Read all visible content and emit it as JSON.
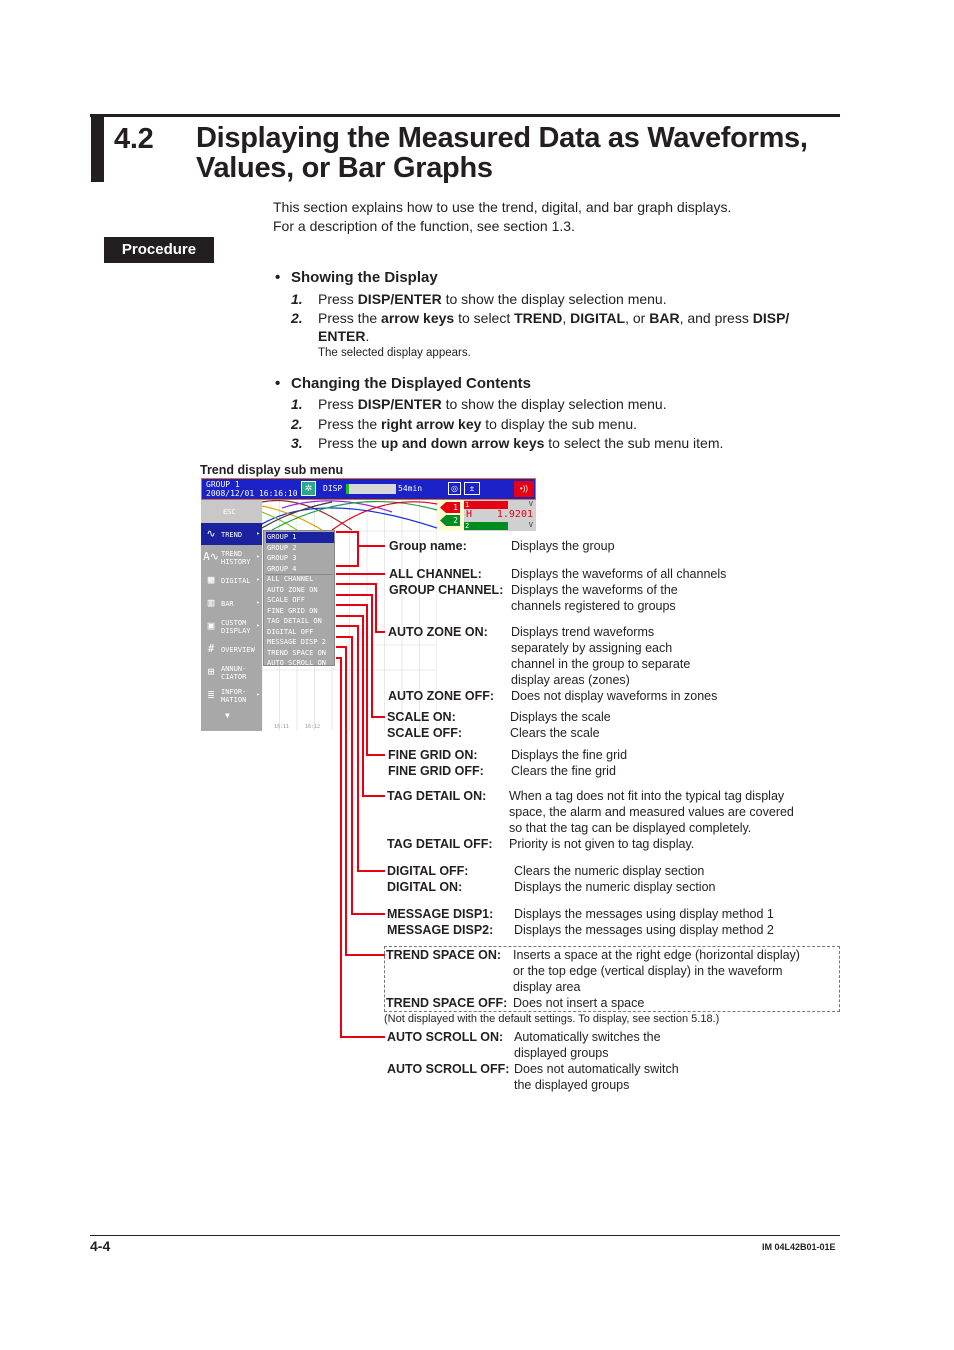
{
  "header": {
    "section_number": "4.2",
    "section_title": "Displaying the Measured Data as Waveforms, Values, or Bar Graphs",
    "intro_lines": [
      "This section explains how to use the trend, digital, and bar graph displays.",
      "For a description of the function, see section 1.3."
    ],
    "procedure_label": "Procedure"
  },
  "showing": {
    "heading": "Showing the Display",
    "steps": [
      {
        "num": "1.",
        "parts": [
          [
            "Press ",
            false
          ],
          [
            "DISP/ENTER",
            true
          ],
          [
            " to show the display selection menu.",
            false
          ]
        ]
      },
      {
        "num": "2.",
        "parts": [
          [
            "Press the ",
            false
          ],
          [
            "arrow keys",
            true
          ],
          [
            " to select ",
            false
          ],
          [
            "TREND",
            true
          ],
          [
            ", ",
            false
          ],
          [
            "DIGITAL",
            true
          ],
          [
            ", or ",
            false
          ],
          [
            "BAR",
            true
          ],
          [
            ", and press ",
            false
          ],
          [
            "DISP/",
            true
          ]
        ]
      },
      {
        "num": "",
        "parts": [
          [
            "ENTER",
            true
          ],
          [
            ".",
            false
          ]
        ]
      }
    ],
    "note": "The selected display appears."
  },
  "changing": {
    "heading": "Changing the Displayed Contents",
    "steps": [
      {
        "num": "1.",
        "parts": [
          [
            "Press ",
            false
          ],
          [
            "DISP/ENTER",
            true
          ],
          [
            " to show the display selection menu.",
            false
          ]
        ]
      },
      {
        "num": "2.",
        "parts": [
          [
            "Press the ",
            false
          ],
          [
            "right arrow key",
            true
          ],
          [
            " to display the sub menu.",
            false
          ]
        ]
      },
      {
        "num": "3.",
        "parts": [
          [
            "Press the ",
            false
          ],
          [
            "up and down arrow keys",
            true
          ],
          [
            " to select the sub menu item.",
            false
          ]
        ]
      }
    ]
  },
  "figure": {
    "caption": "Trend display sub menu",
    "screen": {
      "group": "GROUP 1",
      "datetime": "2008/12/01 16:16:10",
      "disp_label": "DISP",
      "memory_remaining": "54min",
      "memory_fill": 0.06,
      "ch1_tag": "1",
      "ch2_tag": "2",
      "ch1_alarm": "H",
      "ch1_value": "1.9201",
      "ch_unit": "V",
      "side_menu": [
        {
          "label": "ESC",
          "label2": "",
          "icon": "",
          "arrow": ""
        },
        {
          "label": "TREND",
          "label2": "",
          "icon": "∿",
          "arrow": "▸"
        },
        {
          "label": "TREND",
          "label2": "HISTORY",
          "icon": "A∿",
          "arrow": "▸"
        },
        {
          "label": "DIGITAL",
          "label2": "",
          "icon": "▦",
          "arrow": "▸"
        },
        {
          "label": "BAR",
          "label2": "",
          "icon": "▥",
          "arrow": "▸"
        },
        {
          "label": "CUSTOM",
          "label2": "DISPLAY",
          "icon": "▣",
          "arrow": "▸"
        },
        {
          "label": "OVERVIEW",
          "label2": "",
          "icon": "#",
          "arrow": ""
        },
        {
          "label": "ANNUN-",
          "label2": "CIATOR",
          "icon": "⊞",
          "arrow": ""
        },
        {
          "label": "INFOR-",
          "label2": "MATION",
          "icon": "≣",
          "arrow": "▸"
        }
      ],
      "more_arrow": "▼",
      "sub_menu": [
        "GROUP 1",
        "GROUP 2",
        "GROUP 3",
        "GROUP 4",
        "ALL CHANNEL",
        "AUTO ZONE ON",
        "SCALE OFF",
        "FINE GRID ON",
        "TAG DETAIL ON",
        "DIGITAL OFF",
        "MESSAGE DISP 2",
        "TREND SPACE ON",
        "AUTO SCROLL ON"
      ],
      "time_marks": [
        "16:11",
        "16:12"
      ],
      "colors": {
        "title_bar": "#1a22c8",
        "menu_gray": "#a8a8a8",
        "selection": "#1a22a0",
        "ch1": "#e60012",
        "ch2": "#008c1e",
        "callout_line": "#e60012"
      }
    },
    "callouts": [
      {
        "label": "Group name:",
        "desc": [
          "Displays the group"
        ]
      },
      {
        "label": "ALL CHANNEL:",
        "desc": [
          "Displays the waveforms of all channels"
        ]
      },
      {
        "label": "GROUP CHANNEL:",
        "desc": [
          "Displays the waveforms of the",
          "channels registered to groups"
        ]
      },
      {
        "label": "AUTO ZONE ON:",
        "desc": [
          "Displays trend waveforms",
          "separately by assigning each",
          "channel in the group to separate",
          "display areas (zones)"
        ]
      },
      {
        "label": "AUTO ZONE OFF:",
        "desc": [
          "Does not display waveforms in zones"
        ]
      },
      {
        "label": "SCALE ON:",
        "desc": [
          "Displays the scale"
        ]
      },
      {
        "label": "SCALE OFF:",
        "desc": [
          "Clears the scale"
        ]
      },
      {
        "label": "FINE GRID ON:",
        "desc": [
          "Displays the fine grid"
        ]
      },
      {
        "label": "FINE GRID OFF:",
        "desc": [
          "Clears the fine grid"
        ]
      },
      {
        "label": "TAG DETAIL ON:",
        "desc": [
          "When a tag does not fit into the typical tag display",
          "space, the alarm and measured values are covered",
          "so that the tag can be displayed completely."
        ]
      },
      {
        "label": "TAG DETAIL OFF:",
        "desc": [
          "Priority is not given to tag display."
        ]
      },
      {
        "label": "DIGITAL OFF:",
        "desc": [
          "Clears the numeric display section"
        ]
      },
      {
        "label": "DIGITAL ON:",
        "desc": [
          "Displays the numeric display section"
        ]
      },
      {
        "label": "MESSAGE DISP1:",
        "desc": [
          "Displays the messages using display method 1"
        ]
      },
      {
        "label": "MESSAGE DISP2:",
        "desc": [
          "Displays the messages using display method 2"
        ]
      },
      {
        "label": "TREND SPACE ON:",
        "desc": [
          "Inserts a space at the right edge (horizontal display)",
          "or the top edge (vertical display) in the waveform",
          "display area"
        ]
      },
      {
        "label": "TREND SPACE OFF:",
        "desc": [
          "Does not insert a space"
        ]
      },
      {
        "label": "AUTO SCROLL ON:",
        "desc": [
          "Automatically switches the",
          "displayed groups"
        ]
      },
      {
        "label": "AUTO SCROLL OFF:",
        "desc": [
          "Does not automatically switch",
          "the displayed groups"
        ]
      }
    ],
    "trend_space_note": "(Not displayed with the default settings. To display, see section 5.18.)"
  },
  "footer": {
    "page_number": "4-4",
    "doc_id": "IM 04L42B01-01E"
  }
}
